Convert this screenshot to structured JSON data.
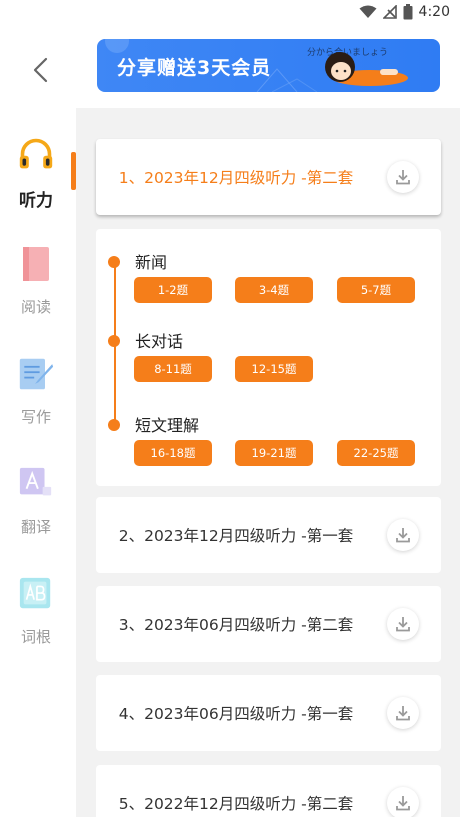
{
  "status": {
    "time": "4:20"
  },
  "banner": {
    "title": "分享赠送3天会员",
    "sub": "分から合いましょう"
  },
  "sidebar": {
    "items": [
      {
        "label": "听力",
        "icon": "headphones-icon",
        "active": true
      },
      {
        "label": "阅读",
        "icon": "book-icon",
        "active": false
      },
      {
        "label": "写作",
        "icon": "notepad-pen-icon",
        "active": false
      },
      {
        "label": "翻译",
        "icon": "translate-icon",
        "active": false
      },
      {
        "label": "词根",
        "icon": "ab-word-icon",
        "active": false
      }
    ]
  },
  "papers": [
    {
      "title": "1、2023年12月四级听力 -第二套",
      "expanded": true
    },
    {
      "title": "2、2023年12月四级听力 -第一套",
      "expanded": false
    },
    {
      "title": "3、2023年06月四级听力 -第二套",
      "expanded": false
    },
    {
      "title": "4、2023年06月四级听力 -第一套",
      "expanded": false
    },
    {
      "title": "5、2022年12月四级听力 -第二套",
      "expanded": false
    }
  ],
  "sections": [
    {
      "title": "新闻",
      "chips": [
        "1-2题",
        "3-4题",
        "5-7题"
      ]
    },
    {
      "title": "长对话",
      "chips": [
        "8-11题",
        "12-15题"
      ]
    },
    {
      "title": "短文理解",
      "chips": [
        "16-18题",
        "19-21题",
        "22-25题"
      ]
    }
  ],
  "colors": {
    "accent": "#f57e1a",
    "banner": "#3f87f5",
    "background": "#f2f2f2"
  }
}
